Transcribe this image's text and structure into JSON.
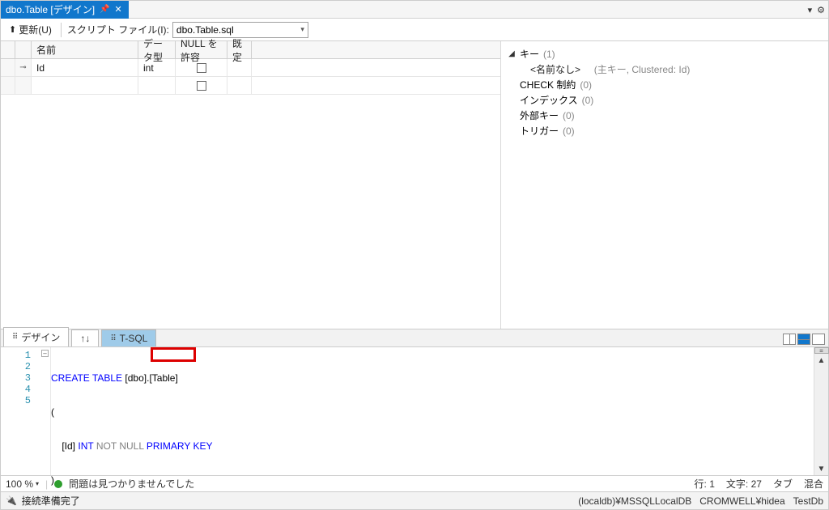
{
  "tab": {
    "title": "dbo.Table [デザイン]"
  },
  "toolbar": {
    "update_label": "更新(U)",
    "script_label": "スクリプト ファイル(I):",
    "script_file": "dbo.Table.sql"
  },
  "grid": {
    "headers": {
      "name": "名前",
      "type": "データ型",
      "null": "NULL を許容",
      "default": "既定"
    },
    "rows": [
      {
        "pk": true,
        "name": "Id",
        "type": "int",
        "allow_null": false,
        "default": ""
      }
    ]
  },
  "props": {
    "keys": {
      "label": "キー",
      "count": "(1)"
    },
    "key_detail": {
      "name": "<名前なし>",
      "desc": "(主キー, Clustered: Id)"
    },
    "check": {
      "label": "CHECK 制約",
      "count": "(0)"
    },
    "index": {
      "label": "インデックス",
      "count": "(0)"
    },
    "fk": {
      "label": "外部キー",
      "count": "(0)"
    },
    "trigger": {
      "label": "トリガー",
      "count": "(0)"
    }
  },
  "panetabs": {
    "design": "デザイン",
    "swap": "↑↓",
    "tsql": "T-SQL"
  },
  "code": {
    "lines": [
      "1",
      "2",
      "3",
      "4",
      "5"
    ],
    "l1_kw1": "CREATE",
    "l1_kw2": "TABLE",
    "l1_schema": "[dbo]",
    "l1_dot": ".",
    "l1_table": "[Table]",
    "l2": "(",
    "l3_col": "[Id]",
    "l3_kw1": "INT",
    "l3_g1": "NOT",
    "l3_g2": "NULL",
    "l3_kw2": "PRIMARY",
    "l3_kw3": "KEY",
    "l4": ")"
  },
  "codestatus": {
    "zoom": "100 %",
    "ok_msg": "問題は見つかりませんでした",
    "line_lbl": "行:",
    "line_val": "1",
    "col_lbl": "文字:",
    "col_val": "27",
    "tab_lbl": "タブ",
    "mode": "混合"
  },
  "statusbar": {
    "conn": "接続準備完了",
    "server": "(localdb)¥MSSQLLocalDB",
    "user": "CROMWELL¥hidea",
    "db": "TestDb"
  }
}
